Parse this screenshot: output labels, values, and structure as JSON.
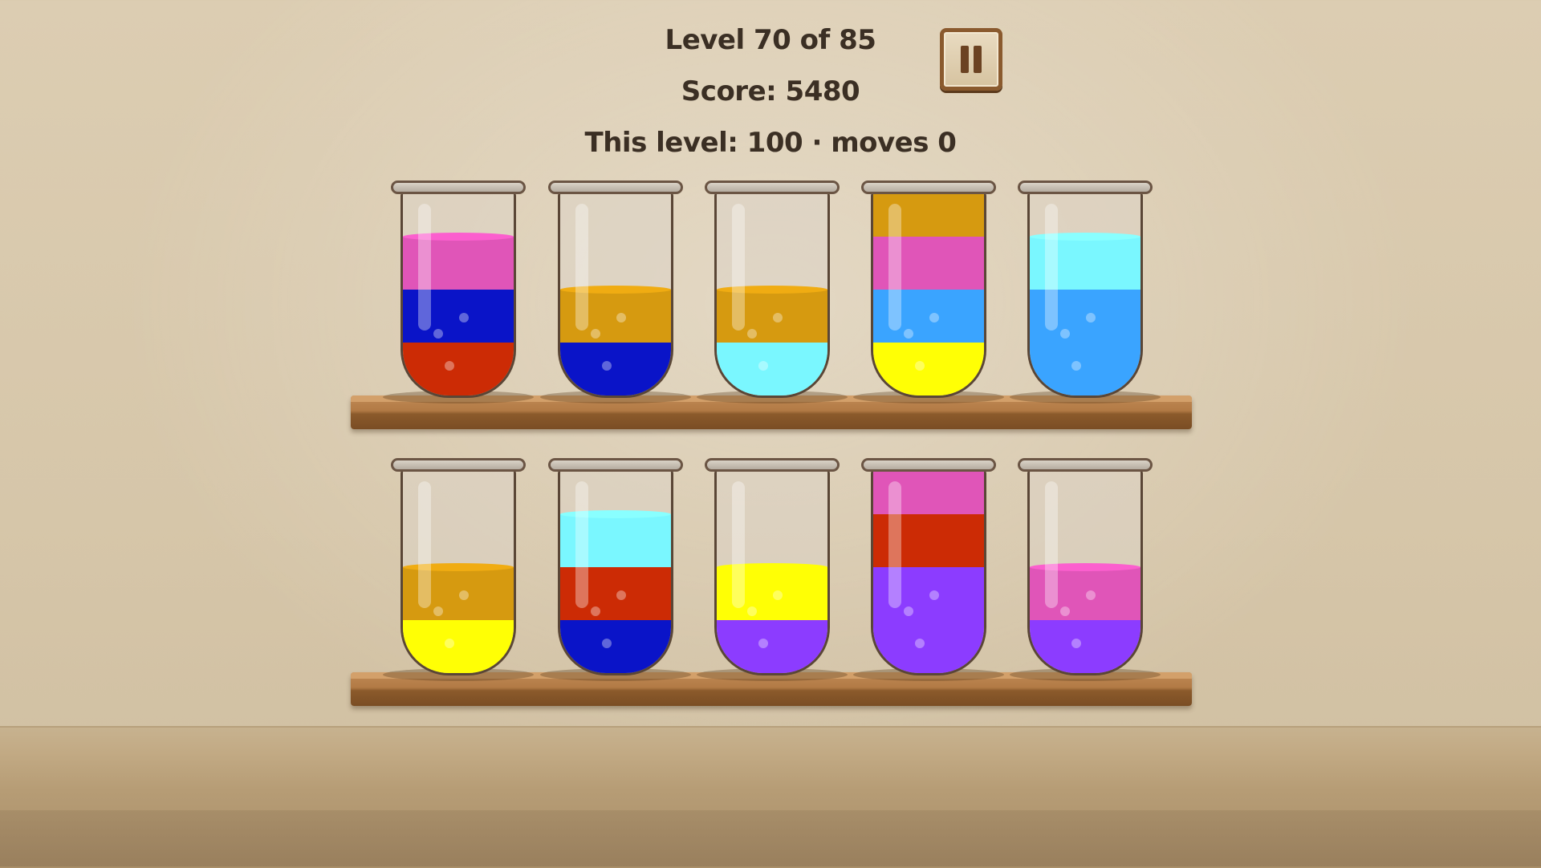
{
  "hud": {
    "level": "Level 70 of 85",
    "score": "Score: 5480",
    "this_level": "This level: 100 · moves 0"
  },
  "pause_button": {
    "icon": "pause-icon"
  },
  "colors": {
    "pink": "#e055b8",
    "blue": "#0a14c8",
    "red": "#cc2b05",
    "amber": "#d69a10",
    "cyan": "#7af7ff",
    "sky": "#3aa4ff",
    "yellow": "#ffff05",
    "purple": "#8c3cff"
  },
  "tube_capacity": 4,
  "shelves": [
    {
      "tubes": [
        {
          "layers": [
            "red",
            "blue",
            "pink"
          ]
        },
        {
          "layers": [
            "blue",
            "amber"
          ]
        },
        {
          "layers": [
            "cyan",
            "amber"
          ]
        },
        {
          "layers": [
            "yellow",
            "sky",
            "pink",
            "amber"
          ]
        },
        {
          "layers": [
            "sky",
            "sky",
            "cyan"
          ]
        }
      ]
    },
    {
      "tubes": [
        {
          "layers": [
            "yellow",
            "amber"
          ]
        },
        {
          "layers": [
            "blue",
            "red",
            "cyan"
          ]
        },
        {
          "layers": [
            "purple",
            "yellow"
          ]
        },
        {
          "layers": [
            "purple",
            "purple",
            "red",
            "pink"
          ]
        },
        {
          "layers": [
            "purple",
            "pink"
          ]
        }
      ]
    }
  ]
}
